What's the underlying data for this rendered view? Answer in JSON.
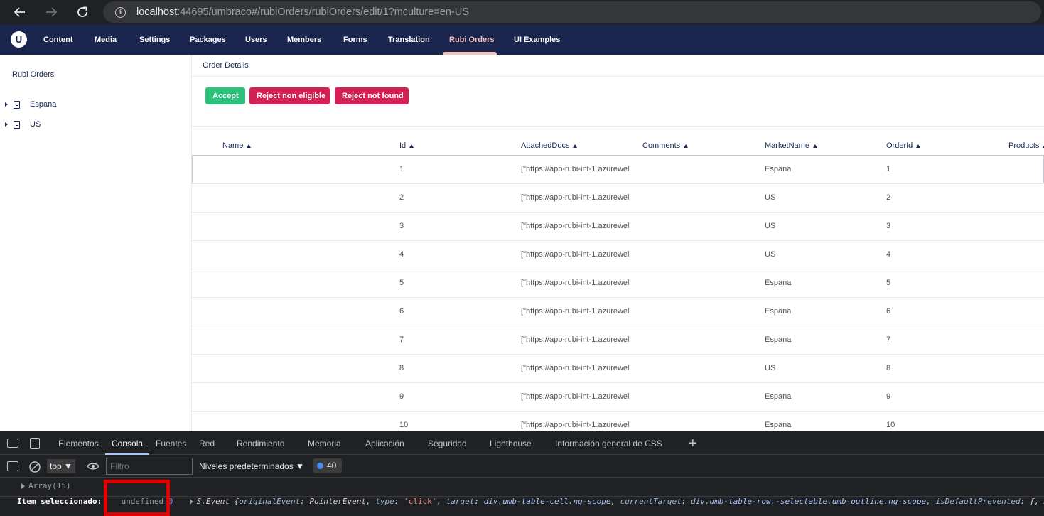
{
  "browser": {
    "url_host": "localhost",
    "url_rest": ":44695/umbraco#/rubiOrders/rubiOrders/edit/1?mculture=en-US"
  },
  "umbraco": {
    "logo": "U",
    "nav": [
      "Content",
      "Media",
      "Settings",
      "Packages",
      "Users",
      "Members",
      "Forms",
      "Translation",
      "Rubi Orders",
      "UI Examples"
    ],
    "active_nav": "Rubi Orders"
  },
  "tree": {
    "title": "Rubi Orders",
    "items": [
      "Espana",
      "US"
    ]
  },
  "main": {
    "title": "Order Details",
    "buttons": {
      "accept": "Accept",
      "reject_non_eligible": "Reject non eligible",
      "reject_not_found": "Reject not found"
    },
    "columns": [
      "Name",
      "Id",
      "AttachedDocs",
      "Comments",
      "MarketName",
      "OrderId",
      "Products"
    ],
    "rows": [
      {
        "name": "",
        "id": "1",
        "docs": "[\"https://app-rubi-int-1.azurewel",
        "comments": "",
        "market": "Espana",
        "order": "1"
      },
      {
        "name": "",
        "id": "2",
        "docs": "[\"https://app-rubi-int-1.azurewel",
        "comments": "",
        "market": "US",
        "order": "2"
      },
      {
        "name": "",
        "id": "3",
        "docs": "[\"https://app-rubi-int-1.azurewel",
        "comments": "",
        "market": "US",
        "order": "3"
      },
      {
        "name": "",
        "id": "4",
        "docs": "[\"https://app-rubi-int-1.azurewel",
        "comments": "",
        "market": "US",
        "order": "4"
      },
      {
        "name": "",
        "id": "5",
        "docs": "[\"https://app-rubi-int-1.azurewel",
        "comments": "",
        "market": "Espana",
        "order": "5"
      },
      {
        "name": "",
        "id": "6",
        "docs": "[\"https://app-rubi-int-1.azurewel",
        "comments": "",
        "market": "Espana",
        "order": "6"
      },
      {
        "name": "",
        "id": "7",
        "docs": "[\"https://app-rubi-int-1.azurewel",
        "comments": "",
        "market": "Espana",
        "order": "7"
      },
      {
        "name": "",
        "id": "8",
        "docs": "[\"https://app-rubi-int-1.azurewel",
        "comments": "",
        "market": "US",
        "order": "8"
      },
      {
        "name": "",
        "id": "9",
        "docs": "[\"https://app-rubi-int-1.azurewel",
        "comments": "",
        "market": "Espana",
        "order": "9"
      },
      {
        "name": "",
        "id": "10",
        "docs": "[\"https://app-rubi-int-1.azurewel",
        "comments": "",
        "market": "Espana",
        "order": "10"
      }
    ]
  },
  "devtools": {
    "tabs": [
      "Elementos",
      "Consola",
      "Fuentes",
      "Red",
      "Rendimiento",
      "Memoria",
      "Aplicación",
      "Seguridad",
      "Lighthouse",
      "Información general de CSS"
    ],
    "active_tab": "Consola",
    "context": "top",
    "filter_placeholder": "Filtro",
    "levels": "Niveles predeterminados",
    "issues_count": "40",
    "console": {
      "line1": "Array(15)",
      "line2_label": "Item seleccionado:",
      "line2_undefined": "undefined",
      "line2_zero": "0",
      "event_prefix": "S.Event {",
      "event_parts": [
        {
          "k": "originalEvent",
          "v": "PointerEvent",
          "t": "cls"
        },
        {
          "k": "type",
          "v": "'click'",
          "t": "str"
        },
        {
          "k": "target",
          "v": "div.umb-table-cell.ng-scope",
          "t": "val"
        },
        {
          "k": "currentTarget",
          "v": "div.umb-table-row.-selectable.umb-outline.ng-scope",
          "t": "val"
        },
        {
          "k": "isDefaultPrevented",
          "v": "ƒ",
          "t": "cls"
        }
      ],
      "event_suffix": "…}"
    }
  },
  "colors": {
    "umb_header": "#1b264f",
    "active_nav": "#f5c1bc",
    "accept": "#2bc37c",
    "reject": "#d42054",
    "highlight_box": "#e00000"
  }
}
